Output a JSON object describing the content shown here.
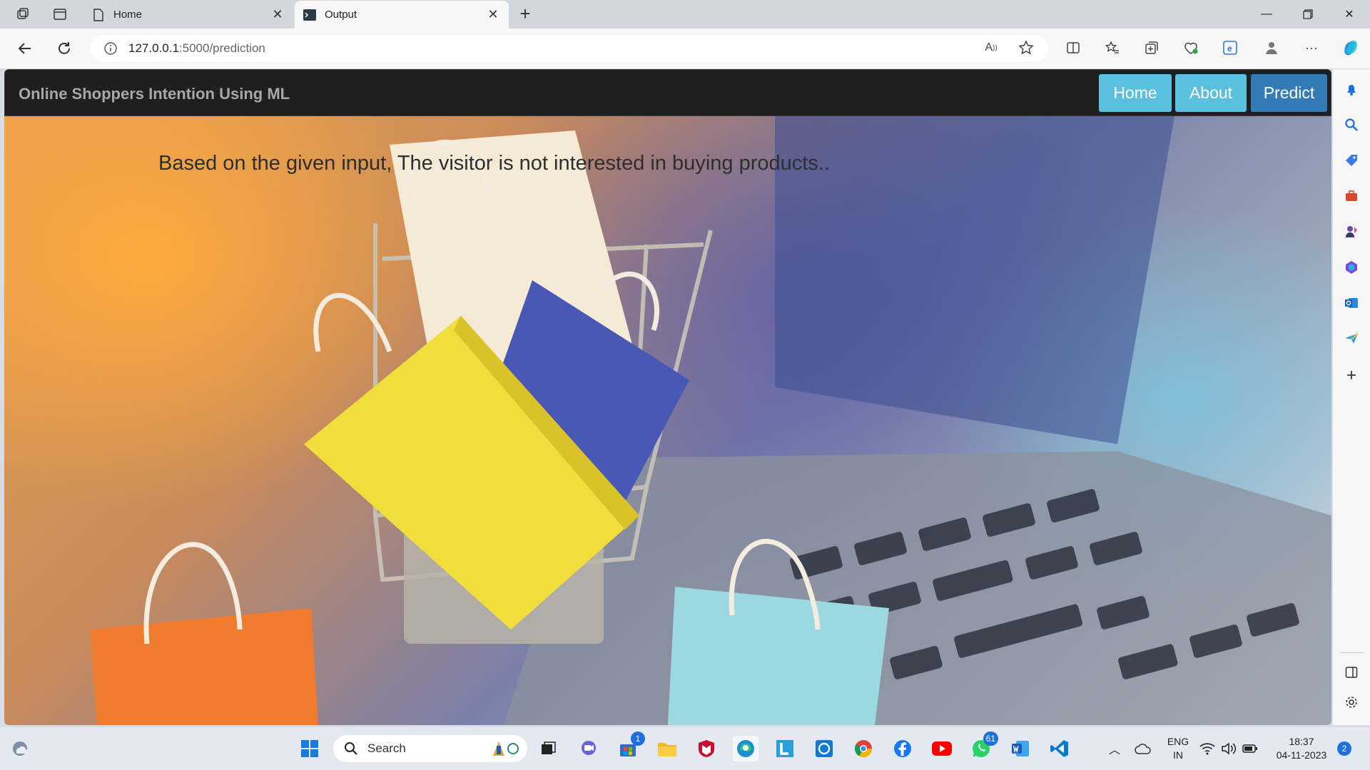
{
  "browser": {
    "tabs": [
      {
        "title": "Home",
        "icon": "page-icon",
        "active": false
      },
      {
        "title": "Output",
        "icon": "terminal-icon",
        "active": true
      }
    ],
    "url": {
      "host": "127.0.0.1",
      "path": ":5000/prediction"
    }
  },
  "site": {
    "brand": "Online Shoppers Intention Using ML",
    "nav": {
      "home": "Home",
      "about": "About",
      "predict": "Predict"
    },
    "result_text": "Based on the given input, The visitor is not interested in buying products..",
    "colors": {
      "navbar": "#1f1f1f",
      "info_button": "#5bc0de",
      "primary_button": "#337ab7"
    }
  },
  "taskbar": {
    "search_label": "Search",
    "badges": {
      "store": "1",
      "whatsapp": "61"
    },
    "language": {
      "line1": "ENG",
      "line2": "IN"
    },
    "time": "18:37",
    "date": "04-11-2023",
    "notifications": "2"
  }
}
